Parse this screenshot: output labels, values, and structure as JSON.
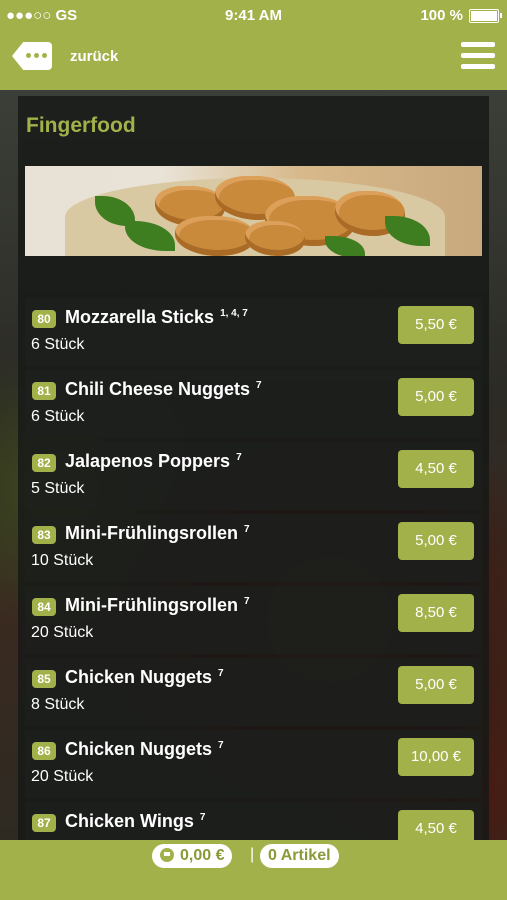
{
  "status_bar": {
    "carrier": "●●●○○ GS",
    "time": "9:41 AM",
    "battery": "100 %"
  },
  "nav": {
    "back_label": "zurück"
  },
  "section": {
    "title": "Fingerfood"
  },
  "items": [
    {
      "number": "80",
      "name": "Mozzarella Sticks",
      "additives": "1, 4, 7",
      "qty": "6 Stück",
      "price": "5,50 €"
    },
    {
      "number": "81",
      "name": "Chili Cheese Nuggets",
      "additives": "7",
      "qty": "6 Stück",
      "price": "5,00 €"
    },
    {
      "number": "82",
      "name": "Jalapenos Poppers",
      "additives": "7",
      "qty": "5 Stück",
      "price": "4,50 €"
    },
    {
      "number": "83",
      "name": "Mini-Frühlingsrollen",
      "additives": "7",
      "qty": "10 Stück",
      "price": "5,00 €"
    },
    {
      "number": "84",
      "name": "Mini-Frühlingsrollen",
      "additives": "7",
      "qty": "20 Stück",
      "price": "8,50 €"
    },
    {
      "number": "85",
      "name": "Chicken Nuggets",
      "additives": "7",
      "qty": "8 Stück",
      "price": "5,00 €"
    },
    {
      "number": "86",
      "name": "Chicken Nuggets",
      "additives": "7",
      "qty": "20 Stück",
      "price": "10,00 €"
    },
    {
      "number": "87",
      "name": "Chicken Wings",
      "additives": "7",
      "qty": "",
      "price": "4,50 €"
    }
  ],
  "cart": {
    "total": "0,00 €",
    "separator": "|",
    "count": "0 Artikel"
  },
  "colors": {
    "accent": "#a3b14a",
    "panel": "#161816"
  },
  "icons": [
    "back-icon",
    "menu-icon",
    "wifi-icon",
    "battery-icon",
    "cart-icon"
  ]
}
